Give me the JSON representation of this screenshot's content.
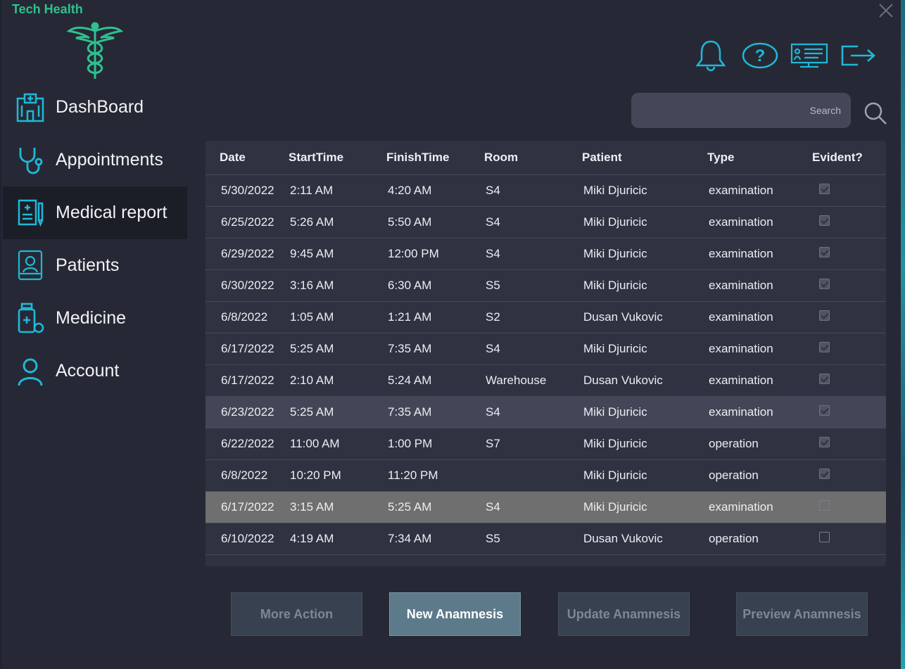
{
  "app": {
    "title": "Tech Health"
  },
  "sidebar": {
    "items": [
      {
        "label": "DashBoard",
        "icon": "hospital-icon"
      },
      {
        "label": "Appointments",
        "icon": "stethoscope-icon"
      },
      {
        "label": "Medical report",
        "icon": "medical-report-icon"
      },
      {
        "label": "Patients",
        "icon": "patient-bed-icon"
      },
      {
        "label": "Medicine",
        "icon": "medicine-bottle-icon"
      },
      {
        "label": "Account",
        "icon": "user-icon"
      }
    ],
    "active": "Medical report"
  },
  "search": {
    "placeholder": "Search"
  },
  "table": {
    "headers": [
      "Date",
      "StartTime",
      "FinishTime",
      "Room",
      "Patient",
      "Type",
      "Evident?"
    ],
    "rows": [
      {
        "date": "5/30/2022",
        "start": "2:11 AM",
        "finish": "4:20 AM",
        "room": "S4",
        "patient": "Miki Djuricic",
        "type": "examination",
        "evident": true
      },
      {
        "date": "6/25/2022",
        "start": "5:26 AM",
        "finish": "5:50 AM",
        "room": "S4",
        "patient": "Miki Djuricic",
        "type": "examination",
        "evident": true
      },
      {
        "date": "6/29/2022",
        "start": "9:45 AM",
        "finish": "12:00 PM",
        "room": "S4",
        "patient": "Miki Djuricic",
        "type": "examination",
        "evident": true
      },
      {
        "date": "6/30/2022",
        "start": "3:16 AM",
        "finish": "6:30 AM",
        "room": "S5",
        "patient": "Miki Djuricic",
        "type": "examination",
        "evident": true
      },
      {
        "date": "6/8/2022",
        "start": "1:05 AM",
        "finish": "1:21 AM",
        "room": "S2",
        "patient": "Dusan Vukovic",
        "type": "examination",
        "evident": true
      },
      {
        "date": "6/17/2022",
        "start": "5:25 AM",
        "finish": "7:35 AM",
        "room": "S4",
        "patient": "Miki Djuricic",
        "type": "examination",
        "evident": true
      },
      {
        "date": "6/17/2022",
        "start": "2:10 AM",
        "finish": "5:24 AM",
        "room": "Warehouse",
        "patient": "Dusan Vukovic",
        "type": "examination",
        "evident": true
      },
      {
        "date": "6/23/2022",
        "start": "5:25 AM",
        "finish": "7:35 AM",
        "room": "S4",
        "patient": "Miki Djuricic",
        "type": "examination",
        "evident": true
      },
      {
        "date": "6/22/2022",
        "start": "11:00 AM",
        "finish": "1:00 PM",
        "room": "S7",
        "patient": "Miki Djuricic",
        "type": "operation",
        "evident": true
      },
      {
        "date": "6/8/2022",
        "start": "10:20 PM",
        "finish": "11:20 PM",
        "room": "",
        "patient": "Miki Djuricic",
        "type": "operation",
        "evident": true
      },
      {
        "date": "6/17/2022",
        "start": "3:15 AM",
        "finish": "5:25 AM",
        "room": "S4",
        "patient": "Miki Djuricic",
        "type": "examination",
        "evident": false
      },
      {
        "date": "6/10/2022",
        "start": "4:19 AM",
        "finish": "7:34 AM",
        "room": "S5",
        "patient": "Dusan Vukovic",
        "type": "operation",
        "evident": false
      }
    ],
    "hover_row": 7,
    "selected_row": 10
  },
  "buttons": {
    "more_action": "More Action",
    "new_anamnesis": "New Anamnesis",
    "update_anamnesis": "Update Anamnesis",
    "preview_anamnesis": "Preview Anamnesis"
  },
  "colors": {
    "accent": "#2fc08f",
    "icon_cyan": "#1fb8d8",
    "background": "#262935",
    "table_bg": "#2f3240",
    "selected_row": "#6f6f6f"
  }
}
